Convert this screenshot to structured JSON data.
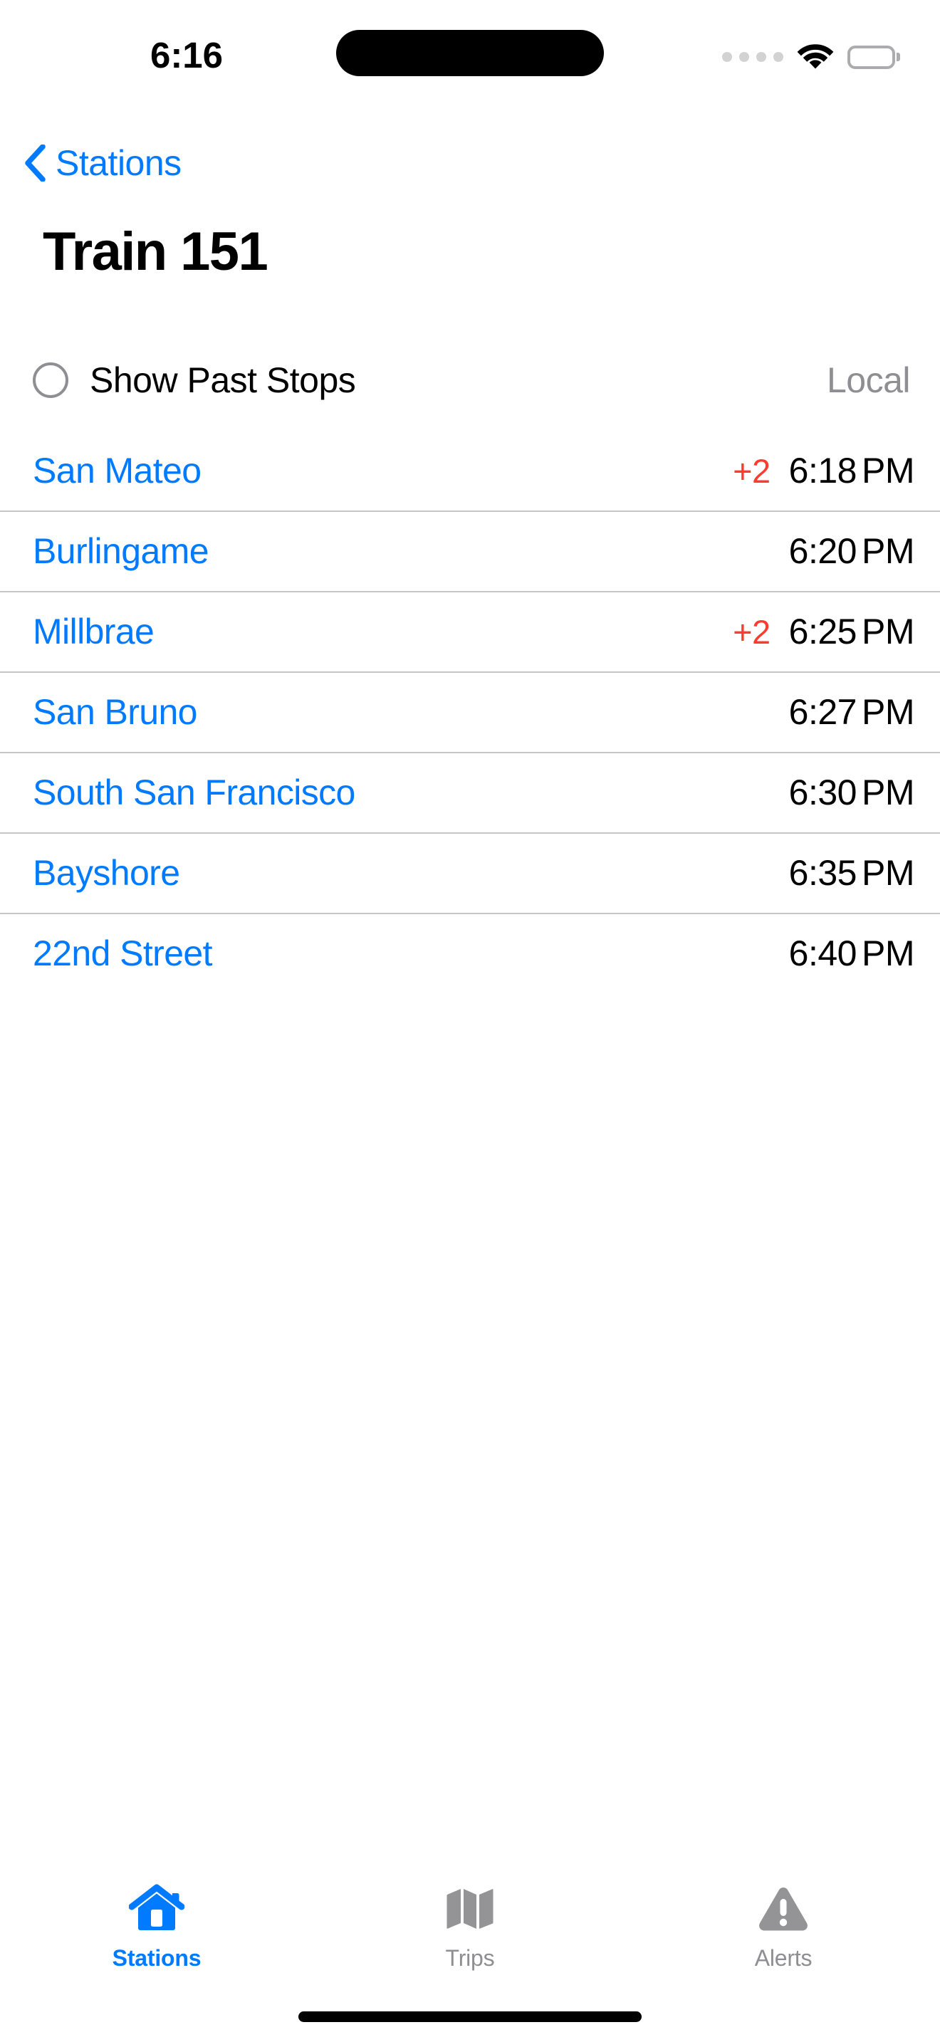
{
  "status_bar": {
    "time": "6:16",
    "cellular_icon": "cellular-dots-icon",
    "wifi_icon": "wifi-icon",
    "battery_icon": "battery-full-icon"
  },
  "nav": {
    "back_icon": "chevron-left-icon",
    "back_label": "Stations"
  },
  "header": {
    "title": "Train 151"
  },
  "options": {
    "toggle_icon": "circle-unchecked-icon",
    "toggle_label": "Show Past Stops",
    "service_type": "Local"
  },
  "stops": [
    {
      "name": "San Mateo",
      "delay": "+2",
      "time": "6:18",
      "ampm": "PM"
    },
    {
      "name": "Burlingame",
      "delay": "",
      "time": "6:20",
      "ampm": "PM"
    },
    {
      "name": "Millbrae",
      "delay": "+2",
      "time": "6:25",
      "ampm": "PM"
    },
    {
      "name": "San Bruno",
      "delay": "",
      "time": "6:27",
      "ampm": "PM"
    },
    {
      "name": "South San Francisco",
      "delay": "",
      "time": "6:30",
      "ampm": "PM"
    },
    {
      "name": "Bayshore",
      "delay": "",
      "time": "6:35",
      "ampm": "PM"
    },
    {
      "name": "22nd Street",
      "delay": "",
      "time": "6:40",
      "ampm": "PM"
    }
  ],
  "tab_bar": {
    "items": [
      {
        "label": "Stations",
        "icon": "house-icon",
        "active": true
      },
      {
        "label": "Trips",
        "icon": "map-folded-icon",
        "active": false
      },
      {
        "label": "Alerts",
        "icon": "warning-triangle-icon",
        "active": false
      }
    ]
  },
  "colors": {
    "accent": "#007AFF",
    "delay": "#FF3B30",
    "secondary_text": "#8E8E93",
    "separator": "#C6C6C8",
    "background": "#FFFFFF"
  }
}
